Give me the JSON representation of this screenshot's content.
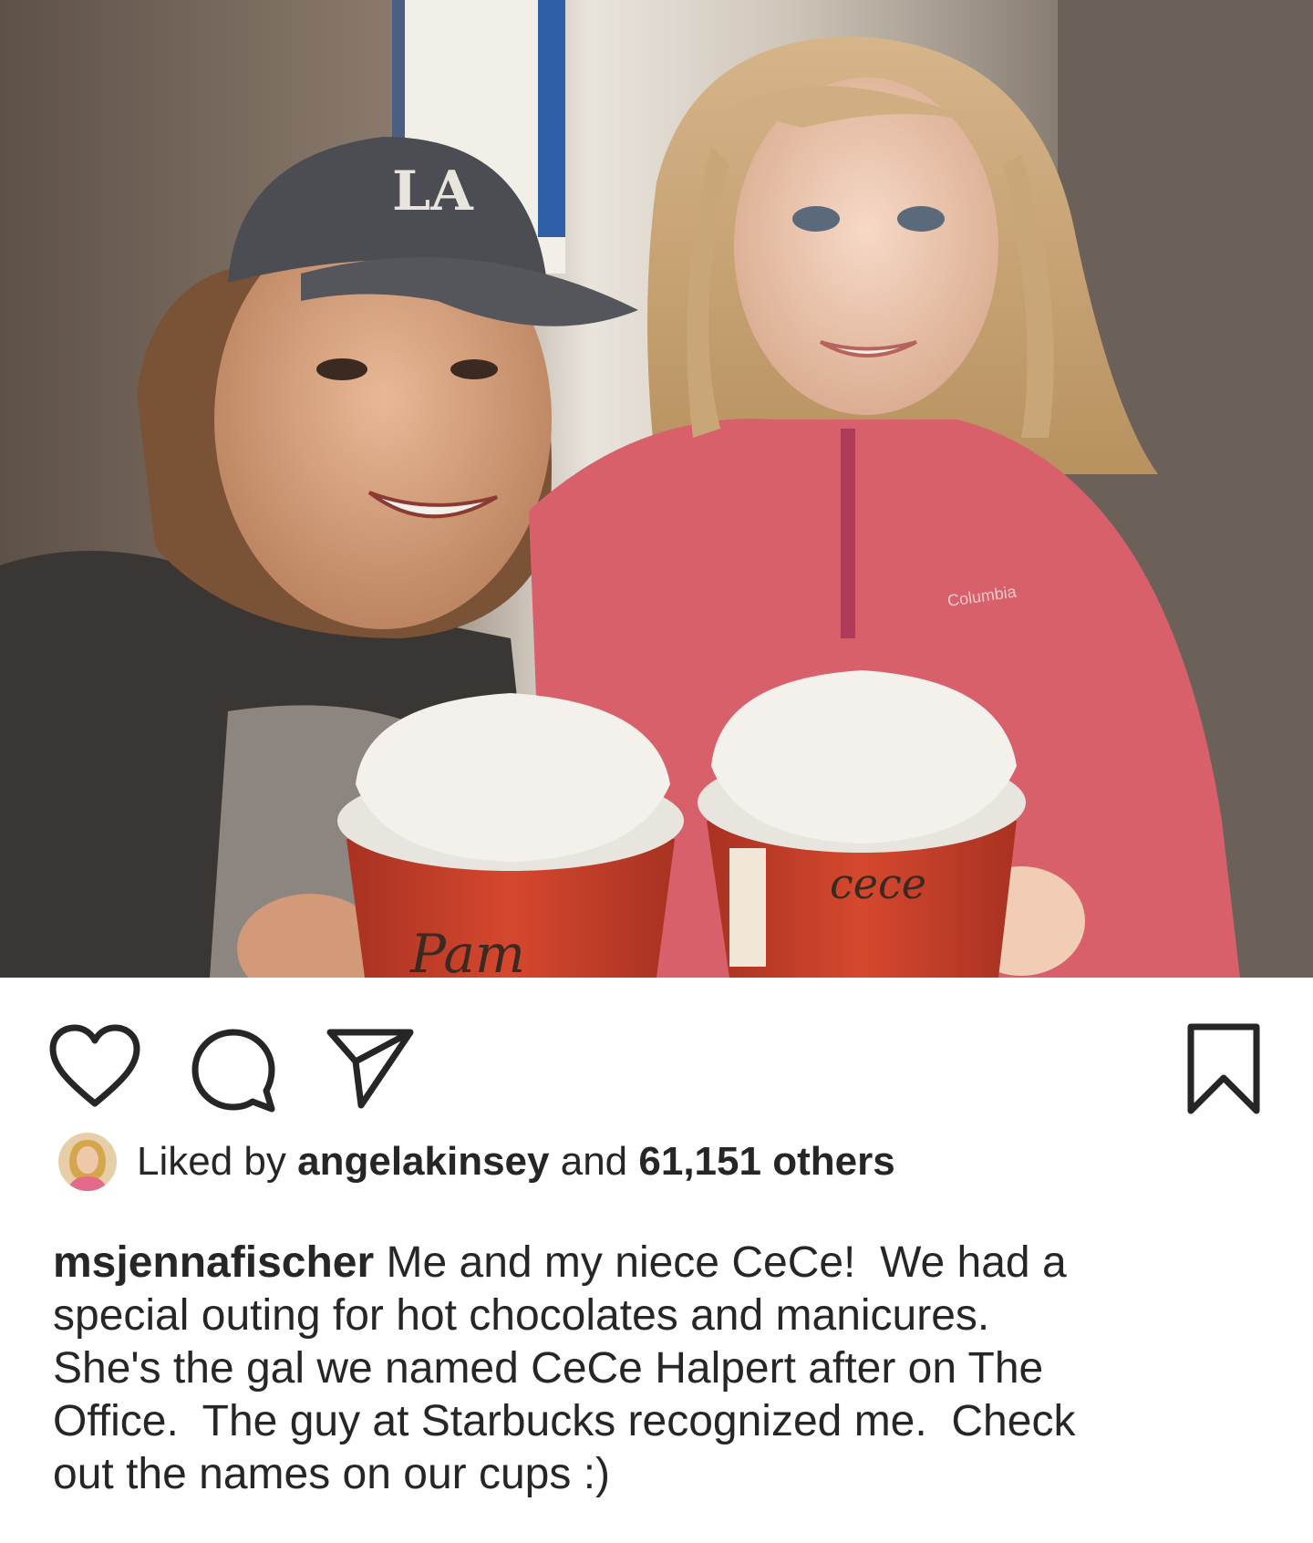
{
  "post": {
    "image_alt": "Selfie of a woman in an LA cap and a young girl in a pink fleece holding red Starbucks cups"
  },
  "actions": {
    "like_icon": "heart-outline-icon",
    "comment_icon": "comment-bubble-icon",
    "share_icon": "paper-plane-icon",
    "save_icon": "bookmark-outline-icon"
  },
  "likes": {
    "prefix": "Liked by",
    "user": "angelakinsey",
    "connector": "and",
    "count_text": "61,151 others"
  },
  "caption": {
    "username": "msjennafischer",
    "first_line_rest": " Me and my niece CeCe!  We had a",
    "lines": [
      "special outing for hot chocolates and manicures.",
      "She's the gal we named CeCe Halpert after on The",
      "Office.  The guy at Starbucks recognized me.  Check",
      "out the names on our cups :)"
    ]
  },
  "photo_text": {
    "cup_left": "Pam",
    "cup_right": "cece",
    "cap_logo": "LA",
    "jacket_brand": "Columbia"
  },
  "colors": {
    "text": "#262626",
    "cup_red": "#c8402a",
    "lid_white": "#f4f1ec",
    "fleece_pink": "#d8606a"
  }
}
